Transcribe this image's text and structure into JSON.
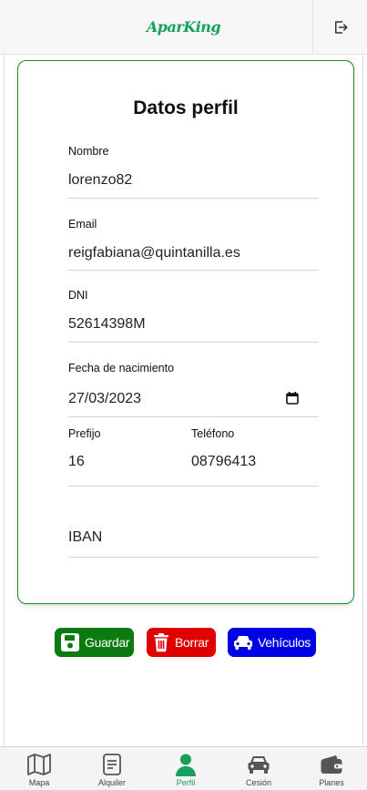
{
  "header": {
    "logo": "AparKing",
    "logout_icon": "logout-icon"
  },
  "profile": {
    "title": "Datos perfil",
    "fields": {
      "nombre": {
        "label": "Nombre",
        "value": "lorenzo82"
      },
      "email": {
        "label": "Email",
        "value": "reigfabiana@quintanilla.es"
      },
      "dni": {
        "label": "DNI",
        "value": "52614398M"
      },
      "fecha": {
        "label": "Fecha de nacimiento",
        "value": "27/03/2023"
      },
      "prefijo": {
        "label": "Prefijo",
        "value": "16"
      },
      "telefono": {
        "label": "Teléfono",
        "value": "08796413"
      },
      "iban": {
        "label": "",
        "placeholder": "IBAN"
      }
    }
  },
  "actions": {
    "save": "Guardar",
    "delete": "Borrar",
    "vehicles": "Vehículos"
  },
  "nav": {
    "items": [
      {
        "label": "Mapa",
        "icon": "map-icon"
      },
      {
        "label": "Alquiler",
        "icon": "document-icon"
      },
      {
        "label": "Perfil",
        "icon": "user-icon",
        "active": true
      },
      {
        "label": "Cesión",
        "icon": "car-icon"
      },
      {
        "label": "Planes",
        "icon": "wallet-icon"
      }
    ]
  },
  "colors": {
    "brand": "#17a05a",
    "card_border": "#1e8a2a",
    "save": "#0b7a10",
    "delete": "#e00000",
    "vehicles": "#0000e6"
  }
}
